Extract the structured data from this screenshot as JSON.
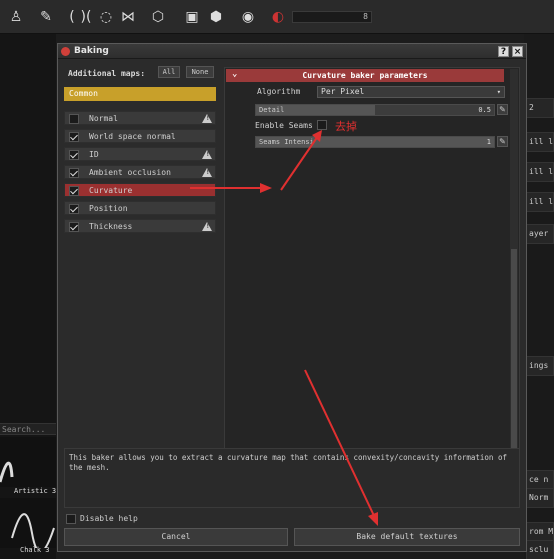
{
  "toolbar": {
    "slider_value": "8"
  },
  "right_side": {
    "items": [
      "2",
      "ill l",
      "ill l",
      "ill l",
      "ayer 7",
      "ings",
      "ce n",
      "Norm",
      "rom M",
      "sclu"
    ]
  },
  "left_side": {
    "search_placeholder": "Search...",
    "thumb1": "Artistic 3",
    "thumb2": "Chalk 3"
  },
  "dialog": {
    "title": "Baking",
    "help_btn": "?",
    "close_btn": "×",
    "additional_maps_label": "Additional maps:",
    "all_btn": "All",
    "none_btn": "None",
    "common_label": "Common",
    "maps": [
      {
        "label": "Normal",
        "checked": false,
        "warn": true
      },
      {
        "label": "World space normal",
        "checked": true,
        "warn": false
      },
      {
        "label": "ID",
        "checked": true,
        "warn": true
      },
      {
        "label": "Ambient occlusion",
        "checked": true,
        "warn": true
      },
      {
        "label": "Curvature",
        "checked": true,
        "warn": false,
        "selected": true
      },
      {
        "label": "Position",
        "checked": true,
        "warn": false
      },
      {
        "label": "Thickness",
        "checked": true,
        "warn": true
      }
    ],
    "panel_header": "Curvature baker parameters",
    "algorithm_label": "Algorithm",
    "algorithm_value": "Per Pixel",
    "detail_label": "Detail",
    "detail_value": "0.5",
    "detail_fraction": 0.5,
    "enable_seams_label": "Enable Seams",
    "annotation_note": "去掉",
    "seams_intensity_label": "Seams Intensi",
    "seams_intensity_value": "1",
    "description": "This baker allows you to extract a curvature map that contains convexity/concavity information of the mesh.",
    "disable_help": "Disable help",
    "cancel_btn": "Cancel",
    "bake_btn": "Bake default textures"
  }
}
